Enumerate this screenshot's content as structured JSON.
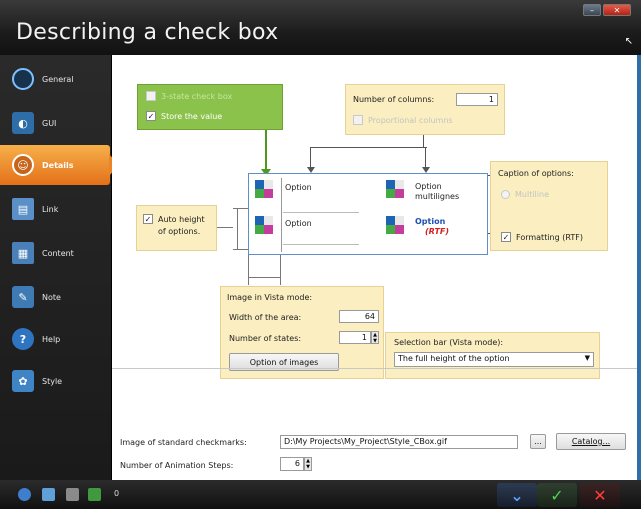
{
  "window": {
    "title": "Describing a check box",
    "buttons": [
      "–",
      "✕"
    ]
  },
  "sidebar": {
    "items": [
      {
        "label": "General",
        "icon": "circle-icon"
      },
      {
        "label": "GUI",
        "icon": "gui-icon"
      },
      {
        "label": "Details",
        "icon": "details-icon",
        "active": true
      },
      {
        "label": "Link",
        "icon": "link-icon"
      },
      {
        "label": "Content",
        "icon": "content-icon"
      },
      {
        "label": "Note",
        "icon": "note-icon"
      },
      {
        "label": "Help",
        "icon": "help-icon"
      },
      {
        "label": "Style",
        "icon": "style-icon"
      }
    ]
  },
  "main": {
    "three_state": {
      "label": "3-state check box",
      "checked": false,
      "enabled": false
    },
    "store_value": {
      "label": "Store the value",
      "checked": true
    },
    "columns": {
      "label": "Number of columns:",
      "value": "1"
    },
    "proportional": {
      "label": "Proportional columns",
      "checked": false,
      "enabled": false
    },
    "caption": {
      "label": "Caption of options:",
      "multiline": {
        "label": "Multiline",
        "enabled": false
      },
      "formatting": {
        "label": "Formatting (RTF)",
        "checked": true
      }
    },
    "auto_height": {
      "label_line1": "Auto height",
      "label_line2": "of options.",
      "checked": true
    },
    "preview": {
      "option1": "Option",
      "option2_line1": "Option",
      "option2_line2": "multilignes",
      "option3": "Option",
      "option4_line1": "Option",
      "option4_line2": "(RTF)"
    },
    "vista": {
      "label": "Image in Vista mode:",
      "width_label": "Width of the area:",
      "width_value": "64",
      "states_label": "Number of states:",
      "states_value": "1",
      "images_button": "Option of images"
    },
    "selection_bar": {
      "label": "Selection bar (Vista mode):",
      "value": "The full height of the option"
    },
    "checkmarks": {
      "label": "Image of standard checkmarks:",
      "value": "D:\\My Projects\\My_Project\\Style_CBox.gif",
      "browse": "...",
      "catalog": "Catalog..."
    },
    "animation": {
      "label": "Number of Animation Steps:",
      "value": "6"
    }
  },
  "footer": {
    "counter": "0"
  },
  "colors": {
    "accent_orange": "#e98428",
    "green_box": "#8ac24b",
    "yellow_box": "#fbeec0",
    "rtf_blue": "#1f4fb0",
    "rtf_red": "#d42020"
  }
}
